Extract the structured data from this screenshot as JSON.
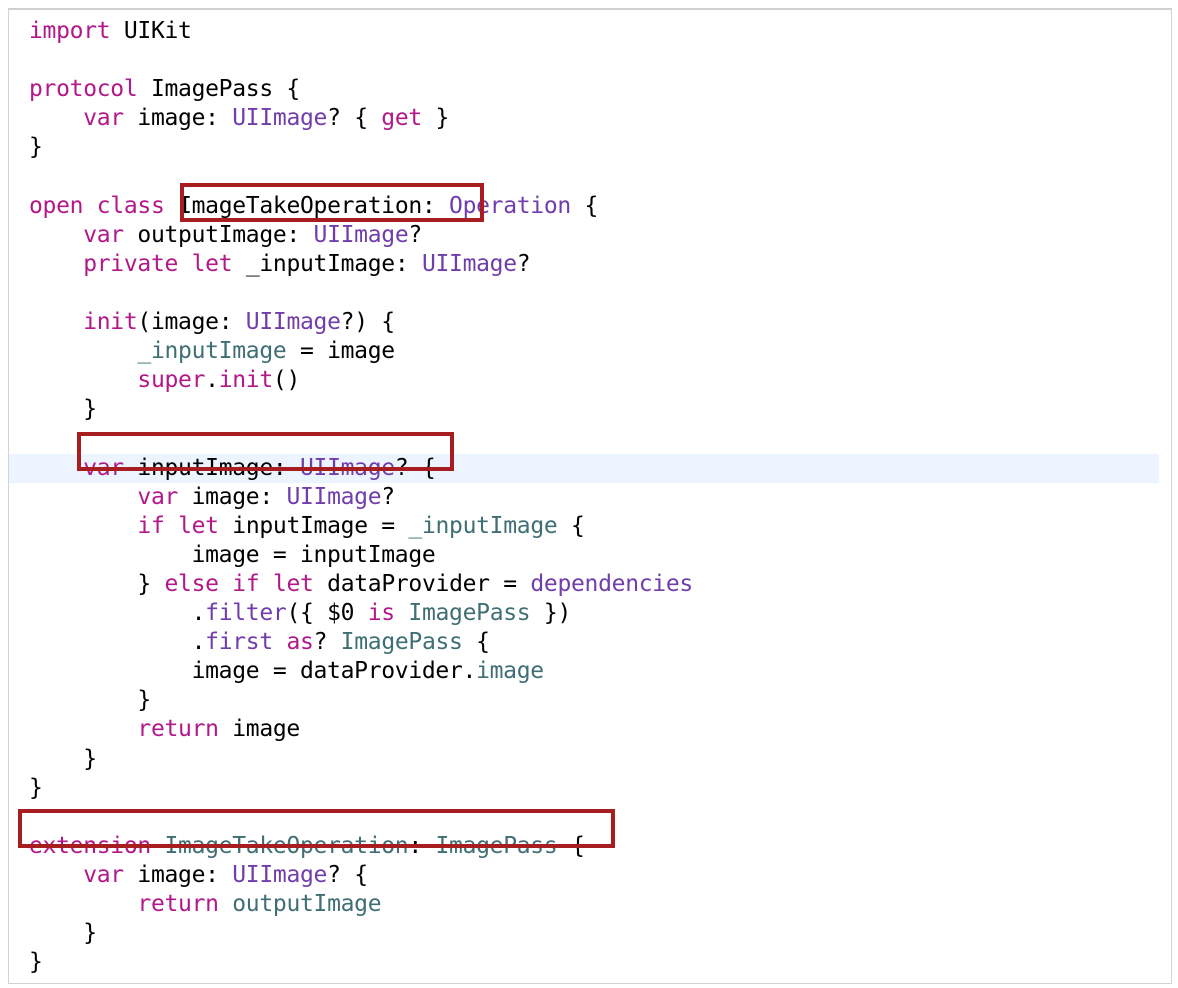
{
  "editor": {
    "highlight_color": "#a71d20",
    "colors": {
      "keyword": "#b21889",
      "system_type": "#703daa",
      "project_symbol": "#3f6e74",
      "plain": "#000000",
      "current_line_background": "#ecf5ff"
    },
    "lines": [
      {
        "indent": "",
        "tokens": [
          {
            "t": "kw",
            "v": "import"
          },
          {
            "t": "p",
            "v": " UIKit"
          }
        ]
      },
      {
        "indent": "",
        "tokens": []
      },
      {
        "indent": "",
        "tokens": [
          {
            "t": "kw",
            "v": "protocol"
          },
          {
            "t": "p",
            "v": " ImagePass {"
          }
        ]
      },
      {
        "indent": "    ",
        "tokens": [
          {
            "t": "kw",
            "v": "var"
          },
          {
            "t": "p",
            "v": " image: "
          },
          {
            "t": "ty",
            "v": "UIImage"
          },
          {
            "t": "p",
            "v": "? { "
          },
          {
            "t": "kw",
            "v": "get"
          },
          {
            "t": "p",
            "v": " }"
          }
        ]
      },
      {
        "indent": "",
        "tokens": [
          {
            "t": "p",
            "v": "}"
          }
        ]
      },
      {
        "indent": "",
        "tokens": []
      },
      {
        "indent": "",
        "tokens": [
          {
            "t": "kw",
            "v": "open"
          },
          {
            "t": "p",
            "v": " "
          },
          {
            "t": "kw",
            "v": "class"
          },
          {
            "t": "p",
            "v": " ImageTakeOperation: "
          },
          {
            "t": "ty",
            "v": "Operation"
          },
          {
            "t": "p",
            "v": " {"
          }
        ]
      },
      {
        "indent": "    ",
        "tokens": [
          {
            "t": "kw",
            "v": "var"
          },
          {
            "t": "p",
            "v": " outputImage: "
          },
          {
            "t": "ty",
            "v": "UIImage"
          },
          {
            "t": "p",
            "v": "?"
          }
        ]
      },
      {
        "indent": "    ",
        "tokens": [
          {
            "t": "kw",
            "v": "private"
          },
          {
            "t": "p",
            "v": " "
          },
          {
            "t": "kw",
            "v": "let"
          },
          {
            "t": "p",
            "v": " _inputImage: "
          },
          {
            "t": "ty",
            "v": "UIImage"
          },
          {
            "t": "p",
            "v": "?"
          }
        ]
      },
      {
        "indent": "",
        "tokens": []
      },
      {
        "indent": "    ",
        "tokens": [
          {
            "t": "kw",
            "v": "init"
          },
          {
            "t": "p",
            "v": "(image: "
          },
          {
            "t": "ty",
            "v": "UIImage"
          },
          {
            "t": "p",
            "v": "?) {"
          }
        ]
      },
      {
        "indent": "        ",
        "tokens": [
          {
            "t": "pr",
            "v": "_inputImage"
          },
          {
            "t": "p",
            "v": " = image"
          }
        ]
      },
      {
        "indent": "        ",
        "tokens": [
          {
            "t": "kw",
            "v": "super"
          },
          {
            "t": "p",
            "v": "."
          },
          {
            "t": "kw",
            "v": "init"
          },
          {
            "t": "p",
            "v": "()"
          }
        ]
      },
      {
        "indent": "    ",
        "tokens": [
          {
            "t": "p",
            "v": "}"
          }
        ]
      },
      {
        "indent": "",
        "tokens": []
      },
      {
        "indent": "    ",
        "current": true,
        "tokens": [
          {
            "t": "kw",
            "v": "var"
          },
          {
            "t": "p",
            "v": " inputImage: "
          },
          {
            "t": "ty",
            "v": "UIImage"
          },
          {
            "t": "p",
            "v": "? {"
          }
        ]
      },
      {
        "indent": "        ",
        "tokens": [
          {
            "t": "kw",
            "v": "var"
          },
          {
            "t": "p",
            "v": " image: "
          },
          {
            "t": "ty",
            "v": "UIImage"
          },
          {
            "t": "p",
            "v": "?"
          }
        ]
      },
      {
        "indent": "        ",
        "tokens": [
          {
            "t": "kw",
            "v": "if"
          },
          {
            "t": "p",
            "v": " "
          },
          {
            "t": "kw",
            "v": "let"
          },
          {
            "t": "p",
            "v": " inputImage = "
          },
          {
            "t": "pr",
            "v": "_inputImage"
          },
          {
            "t": "p",
            "v": " {"
          }
        ]
      },
      {
        "indent": "            ",
        "tokens": [
          {
            "t": "p",
            "v": "image = inputImage"
          }
        ]
      },
      {
        "indent": "        ",
        "tokens": [
          {
            "t": "p",
            "v": "} "
          },
          {
            "t": "kw",
            "v": "else"
          },
          {
            "t": "p",
            "v": " "
          },
          {
            "t": "kw",
            "v": "if"
          },
          {
            "t": "p",
            "v": " "
          },
          {
            "t": "kw",
            "v": "let"
          },
          {
            "t": "p",
            "v": " dataProvider = "
          },
          {
            "t": "ty",
            "v": "dependencies"
          }
        ]
      },
      {
        "indent": "            ",
        "tokens": [
          {
            "t": "p",
            "v": "."
          },
          {
            "t": "ty",
            "v": "filter"
          },
          {
            "t": "p",
            "v": "({ $0 "
          },
          {
            "t": "kw",
            "v": "is"
          },
          {
            "t": "p",
            "v": " "
          },
          {
            "t": "pr",
            "v": "ImagePass"
          },
          {
            "t": "p",
            "v": " })"
          }
        ]
      },
      {
        "indent": "            ",
        "tokens": [
          {
            "t": "p",
            "v": "."
          },
          {
            "t": "ty",
            "v": "first"
          },
          {
            "t": "p",
            "v": " "
          },
          {
            "t": "kw",
            "v": "as"
          },
          {
            "t": "p",
            "v": "? "
          },
          {
            "t": "pr",
            "v": "ImagePass"
          },
          {
            "t": "p",
            "v": " {"
          }
        ]
      },
      {
        "indent": "            ",
        "tokens": [
          {
            "t": "p",
            "v": "image = dataProvider."
          },
          {
            "t": "pr",
            "v": "image"
          }
        ]
      },
      {
        "indent": "        ",
        "tokens": [
          {
            "t": "p",
            "v": "}"
          }
        ]
      },
      {
        "indent": "        ",
        "tokens": [
          {
            "t": "kw",
            "v": "return"
          },
          {
            "t": "p",
            "v": " image"
          }
        ]
      },
      {
        "indent": "    ",
        "tokens": [
          {
            "t": "p",
            "v": "}"
          }
        ]
      },
      {
        "indent": "",
        "tokens": [
          {
            "t": "p",
            "v": "}"
          }
        ]
      },
      {
        "indent": "",
        "tokens": []
      },
      {
        "indent": "",
        "tokens": [
          {
            "t": "kw",
            "v": "extension"
          },
          {
            "t": "p",
            "v": " "
          },
          {
            "t": "pr",
            "v": "ImageTakeOperation"
          },
          {
            "t": "p",
            "v": ": "
          },
          {
            "t": "pr",
            "v": "ImagePass"
          },
          {
            "t": "p",
            "v": " {"
          }
        ]
      },
      {
        "indent": "    ",
        "tokens": [
          {
            "t": "kw",
            "v": "var"
          },
          {
            "t": "p",
            "v": " image: "
          },
          {
            "t": "ty",
            "v": "UIImage"
          },
          {
            "t": "p",
            "v": "? {"
          }
        ]
      },
      {
        "indent": "        ",
        "tokens": [
          {
            "t": "kw",
            "v": "return"
          },
          {
            "t": "p",
            "v": " "
          },
          {
            "t": "pr",
            "v": "outputImage"
          }
        ]
      },
      {
        "indent": "    ",
        "tokens": [
          {
            "t": "p",
            "v": "}"
          }
        ]
      },
      {
        "indent": "",
        "tokens": [
          {
            "t": "p",
            "v": "}"
          }
        ]
      }
    ]
  }
}
